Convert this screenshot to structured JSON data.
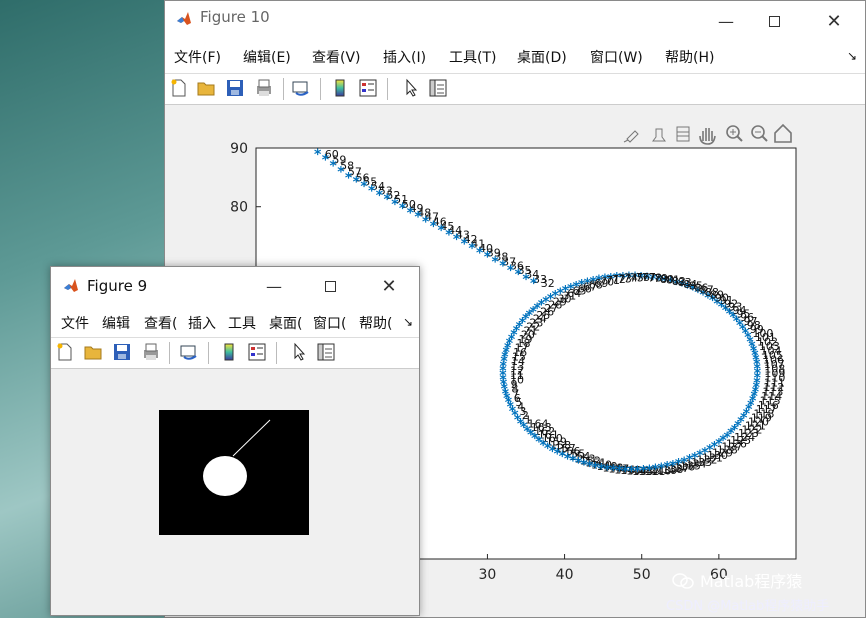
{
  "fig10": {
    "title": "Figure 10",
    "menus": [
      "文件(F)",
      "编辑(E)",
      "查看(V)",
      "插入(I)",
      "工具(T)",
      "桌面(D)",
      "窗口(W)",
      "帮助(H)"
    ],
    "toolbar_icons": [
      "new-file-icon",
      "open-folder-icon",
      "save-icon",
      "print-icon",
      "link-plot-icon",
      "colorbar-icon",
      "legend-icon",
      "arrow-pointer-icon",
      "property-editor-icon"
    ],
    "axes_toolbar_icons": [
      "brush-icon",
      "data-tips-icon",
      "rotate-icon",
      "pan-icon",
      "zoom-in-icon",
      "zoom-out-icon",
      "home-icon"
    ]
  },
  "fig9": {
    "title": "Figure 9",
    "menus": [
      "文件",
      "编辑",
      "查看(",
      "插入",
      "工具",
      "桌面(",
      "窗口(",
      "帮助("
    ],
    "toolbar_icons": [
      "new-file-icon",
      "open-folder-icon",
      "save-icon",
      "print-icon",
      "link-plot-icon",
      "colorbar-icon",
      "legend-icon",
      "arrow-pointer-icon",
      "property-editor-icon"
    ]
  },
  "chart_data": {
    "type": "scatter",
    "marker": "*",
    "color": "#0072bd",
    "x_ticks_visible": [
      30,
      40,
      50,
      60
    ],
    "y_ticks_visible": [
      90,
      80
    ],
    "xlim": [
      0,
      70
    ],
    "ylim": [
      20,
      90
    ],
    "series": [
      {
        "points_line": [
          [
            8,
            89
          ],
          [
            9,
            88
          ],
          [
            10,
            87
          ],
          [
            11,
            86
          ],
          [
            12,
            85
          ],
          [
            13,
            84.3
          ],
          [
            14,
            83.5
          ],
          [
            15,
            82.8
          ],
          [
            16,
            82
          ],
          [
            17,
            81.3
          ],
          [
            18,
            80.5
          ],
          [
            19,
            79.8
          ],
          [
            20,
            79
          ],
          [
            21,
            78.3
          ],
          [
            22,
            77.5
          ],
          [
            23,
            76.7
          ],
          [
            24,
            76
          ],
          [
            25,
            75.3
          ],
          [
            26,
            74.5
          ],
          [
            27,
            73.7
          ],
          [
            28,
            73
          ],
          [
            29,
            72.2
          ],
          [
            30,
            71.5
          ],
          [
            31,
            70.7
          ],
          [
            32,
            70
          ],
          [
            33,
            69.2
          ],
          [
            34,
            68.5
          ],
          [
            35,
            67.7
          ],
          [
            36,
            67
          ]
        ],
        "circle_center": [
          48.5,
          51.5
        ],
        "circle_radius": 16.5
      }
    ],
    "point_labels_visible": [
      "60",
      "59",
      "58",
      "57",
      "56",
      "55",
      "54",
      "53",
      "52",
      "51",
      "50",
      "49",
      "48",
      "47",
      "46",
      "45",
      "44",
      "43",
      "42",
      "41",
      "40",
      "39",
      "38",
      "37",
      "36",
      "35",
      "34",
      "33",
      "32",
      "31",
      "30",
      "29",
      "28",
      "27",
      "26",
      "25",
      "24",
      "23",
      "22",
      "21",
      "20",
      "19",
      "18",
      "17",
      "16",
      "15",
      "14",
      "13",
      "12",
      "11",
      "10",
      "9",
      "8",
      "7",
      "6",
      "5",
      "4",
      "3",
      "2",
      "1",
      "164",
      "163",
      "162",
      "161",
      "160",
      "159",
      "158",
      "157",
      "156",
      "155",
      "154",
      "153",
      "152",
      "151",
      "150",
      "149",
      "148",
      "147",
      "146",
      "145",
      "144",
      "143",
      "142",
      "141",
      "140",
      "139",
      "138",
      "137",
      "136",
      "135",
      "134",
      "133",
      "132",
      "131",
      "130",
      "129",
      "128",
      "127",
      "126",
      "125",
      "124",
      "123",
      "122",
      "121",
      "120",
      "119",
      "118",
      "117",
      "116",
      "115",
      "114",
      "113",
      "112",
      "111",
      "110",
      "109",
      "108",
      "107",
      "106",
      "105",
      "104",
      "103",
      "102",
      "101",
      "100",
      "99",
      "98",
      "97",
      "96",
      "95",
      "94",
      "93",
      "92",
      "91",
      "90",
      "89",
      "88",
      "87",
      "86",
      "85",
      "84",
      "83",
      "82",
      "81",
      "80",
      "79",
      "78",
      "77",
      "76",
      "75",
      "74",
      "73",
      "72",
      "71",
      "70",
      "69",
      "68",
      "67",
      "66",
      "65",
      "64",
      "63",
      "62",
      "61"
    ]
  },
  "binary_image": {
    "background": "#000000",
    "foreground": "#ffffff"
  },
  "watermark": {
    "brand": "Matlab程序猿",
    "credit": "CSDN @Matlab程序猿助手"
  }
}
